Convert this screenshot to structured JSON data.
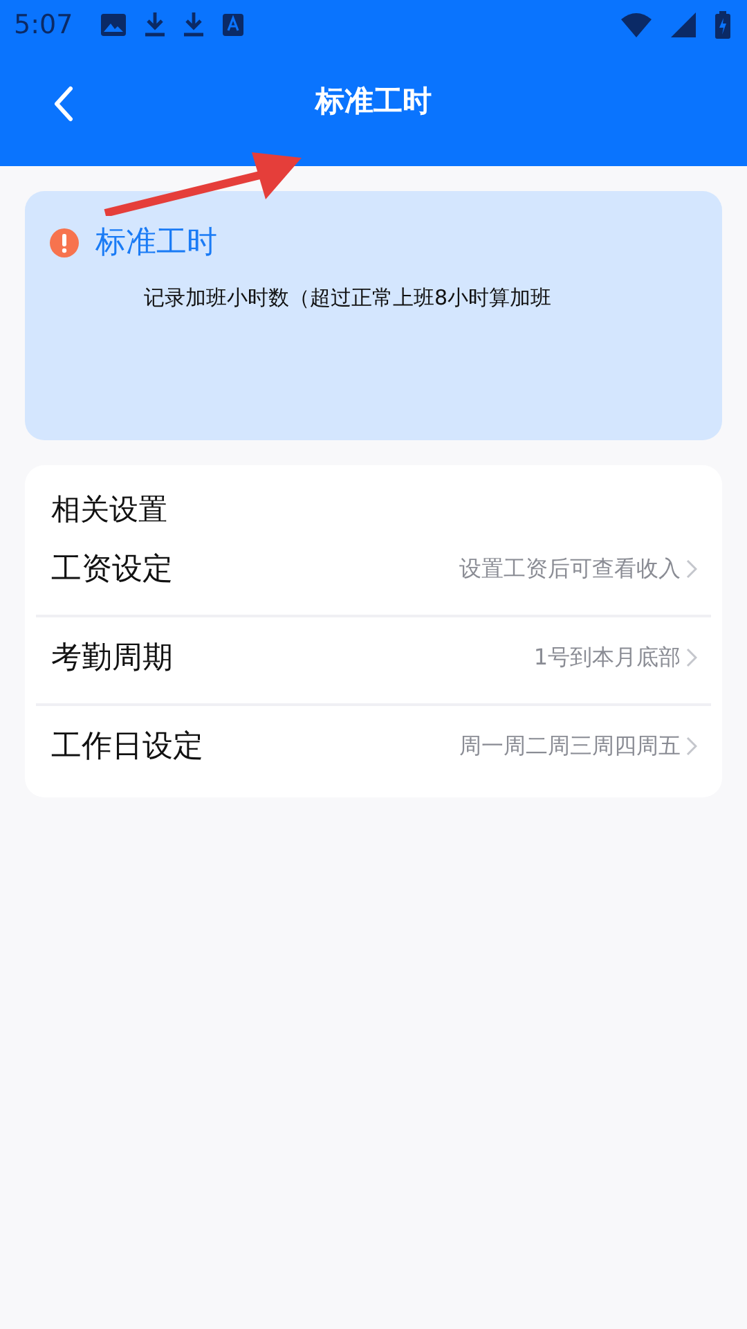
{
  "status_bar": {
    "time": "5:07"
  },
  "header": {
    "title": "标准工时"
  },
  "annotation": {
    "kind": "arrow"
  },
  "info_card": {
    "title": "标准工时",
    "description": "记录加班小时数（超过正常上班8小时算加班"
  },
  "settings": {
    "heading": "相关设置",
    "items": [
      {
        "label": "工资设定",
        "value": "设置工资后可查看收入"
      },
      {
        "label": "考勤周期",
        "value": "1号到本月底部"
      },
      {
        "label": "工作日设定",
        "value": "周一周二周三周四周五"
      }
    ]
  }
}
